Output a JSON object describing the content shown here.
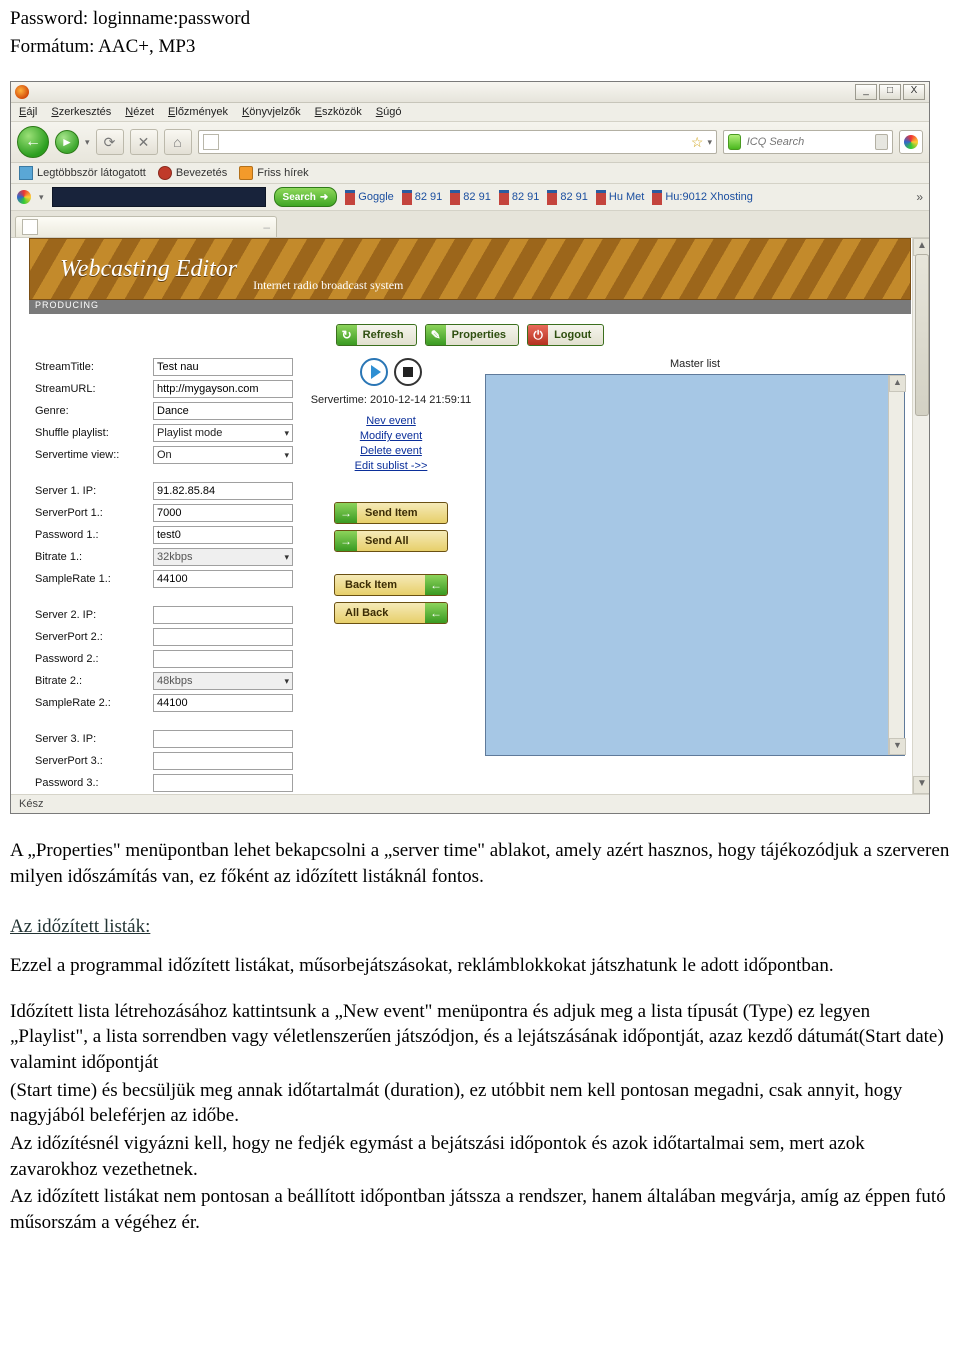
{
  "doc_top": {
    "line1": "Password: loginname:password",
    "line2": "Formátum: AAC+, MP3"
  },
  "browser": {
    "menus": [
      "Eájl",
      "Szerkesztés",
      "Nézet",
      "Előzmények",
      "Könyvjelzők",
      "Eszközök",
      "Súgó"
    ],
    "win": {
      "min": "_",
      "max": "□",
      "close": "X"
    },
    "nav": {
      "back": "←",
      "fwd": "►",
      "reload": "⟳",
      "stop": "✕",
      "home": "⌂",
      "url_value": "",
      "star": "☆",
      "tri": "▾",
      "search_placeholder": "ICQ Search",
      "mag": "🔍"
    },
    "bookmarks": [
      {
        "icon": "blue",
        "label": "Legtöbbször látogatott"
      },
      {
        "icon": "red",
        "label": "Bevezetés"
      },
      {
        "icon": "orange",
        "label": "Friss hírek"
      }
    ],
    "tool_row": {
      "search_label": "Search",
      "search_arrow": "➜",
      "links": [
        "Goggle",
        "82 91",
        "82 91",
        "82 91",
        "82 91",
        "Hu Met",
        "Hu:9012 Xhosting"
      ],
      "more": "»"
    },
    "tab": {
      "dash": "–"
    },
    "status": "Kész"
  },
  "editor": {
    "banner_title": "Webcasting Editor",
    "banner_sub": "Internet radio broadcast system",
    "status": "PRODUCING",
    "toolbar": {
      "refresh_icon": "↻",
      "refresh": "Refresh",
      "props_icon": "✎",
      "properties": "Properties",
      "logout_icon": "⏻",
      "logout": "Logout"
    },
    "left": {
      "stream_title_lab": "StreamTitle:",
      "stream_title": "Test nau",
      "stream_url_lab": "StreamURL:",
      "stream_url": "http://mygayson.com",
      "genre_lab": "Genre:",
      "genre": "Dance",
      "shuffle_lab": "Shuffle playlist:",
      "shuffle": "Playlist mode",
      "stview_lab": "Servertime view::",
      "stview": "On",
      "s1_ip_lab": "Server 1. IP:",
      "s1_ip": "91.82.85.84",
      "s1_port_lab": "ServerPort 1.:",
      "s1_port": "7000",
      "s1_pass_lab": "Password 1.:",
      "s1_pass": "test0",
      "s1_br_lab": "Bitrate 1.:",
      "s1_br": "32kbps",
      "s1_sr_lab": "SampleRate 1.:",
      "s1_sr": "44100",
      "s2_ip_lab": "Server 2. IP:",
      "s2_ip": "",
      "s2_port_lab": "ServerPort 2.:",
      "s2_port": "",
      "s2_pass_lab": "Password 2.:",
      "s2_pass": "",
      "s2_br_lab": "Bitrate 2.:",
      "s2_br": "48kbps",
      "s2_sr_lab": "SampleRate 2.:",
      "s2_sr": "44100",
      "s3_ip_lab": "Server 3. IP:",
      "s3_ip": "",
      "s3_port_lab": "ServerPort 3.:",
      "s3_port": "",
      "s3_pass_lab": "Password 3.:",
      "s3_pass": ""
    },
    "mid": {
      "servertime": "Servertime: 2010-12-14 21:59:11",
      "links": [
        "Nev event",
        "Modify event",
        "Delete event",
        "Edit sublist ->>"
      ],
      "send_item": "Send Item",
      "send_all": "Send All",
      "back_item": "Back Item",
      "all_back": "All Back",
      "arrow_r": "→",
      "arrow_l": "←"
    },
    "right": {
      "master": "Master list",
      "up": "▲",
      "down": "▼"
    }
  },
  "doc_bottom": {
    "p1": "A „Properties\" menüpontban lehet bekapcsolni a „server time\" ablakot, amely azért hasznos, hogy tájékozódjuk a szerveren milyen időszámítás van, ez főként az időzített listáknál fontos.",
    "h1": "Az időzített listák:",
    "p2": "Ezzel a programmal időzített listákat, műsorbejátszásokat, reklámblokkokat játszhatunk le adott időpontban.",
    "p3a": "Időzített lista létrehozásához kattintsunk a „New event\" menüpontra és adjuk meg a lista típusát (Type) ez legyen „Playlist\", a lista sorrendben vagy véletlenszerűen játszódjon, és a lejátszásának időpontját, azaz kezdő dátumát(Start date) valamint időpontját",
    "p3b": "(Start time) és becsüljük meg annak időtartalmát (duration), ez utóbbit nem kell pontosan megadni, csak annyit, hogy nagyjából beleférjen az időbe.",
    "p4": "Az időzítésnél vigyázni kell, hogy ne fedjék egymást a bejátszási időpontok és azok időtartalmai sem, mert azok zavarokhoz vezethetnek.",
    "p5": "Az időzített listákat nem pontosan a beállított időpontban játssza a rendszer, hanem általában megvárja, amíg az éppen futó műsorszám a végéhez ér."
  }
}
